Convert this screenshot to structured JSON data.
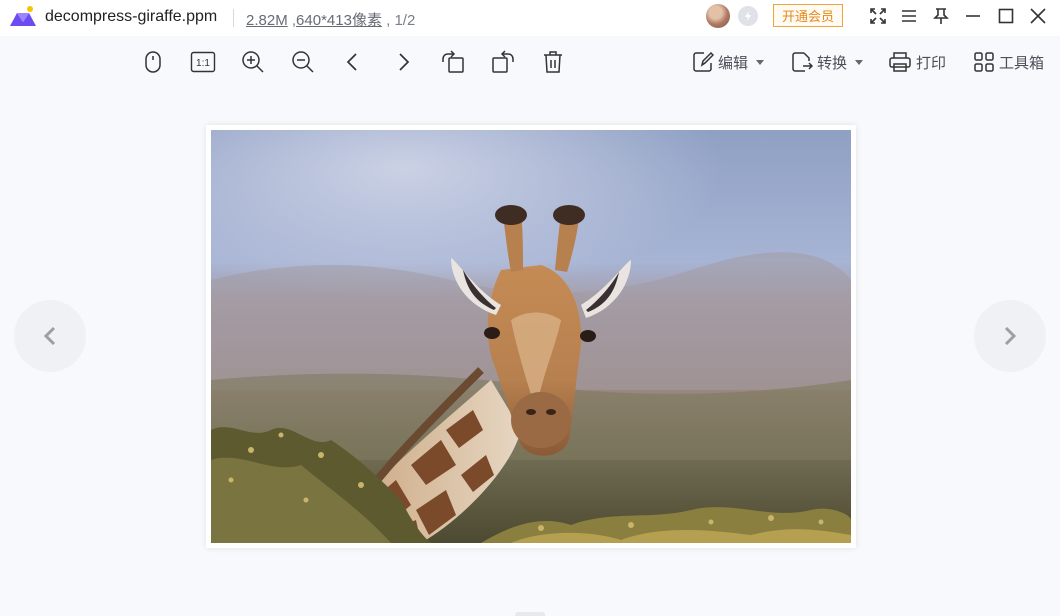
{
  "app": {
    "file_name": "decompress-giraffe.ppm",
    "file_size": "2.82M",
    "dimensions": "640*413像素",
    "page_info": "1/2",
    "vip_label": "开通会员"
  },
  "toolbar": {
    "edit_label": "编辑",
    "convert_label": "转换",
    "print_label": "打印",
    "toolbox_label": "工具箱",
    "icons": [
      "mouse-icon",
      "actual-size-icon",
      "zoom-in-icon",
      "zoom-out-icon",
      "previous-icon",
      "next-icon",
      "rotate-left-icon",
      "rotate-right-icon",
      "delete-icon"
    ]
  },
  "image": {
    "subject": "giraffe"
  },
  "colors": {
    "accent_orange": "#e5891a",
    "background": "#f8f9fc",
    "logo_purple": "#6c4cf0",
    "logo_yellow": "#f5c500"
  }
}
